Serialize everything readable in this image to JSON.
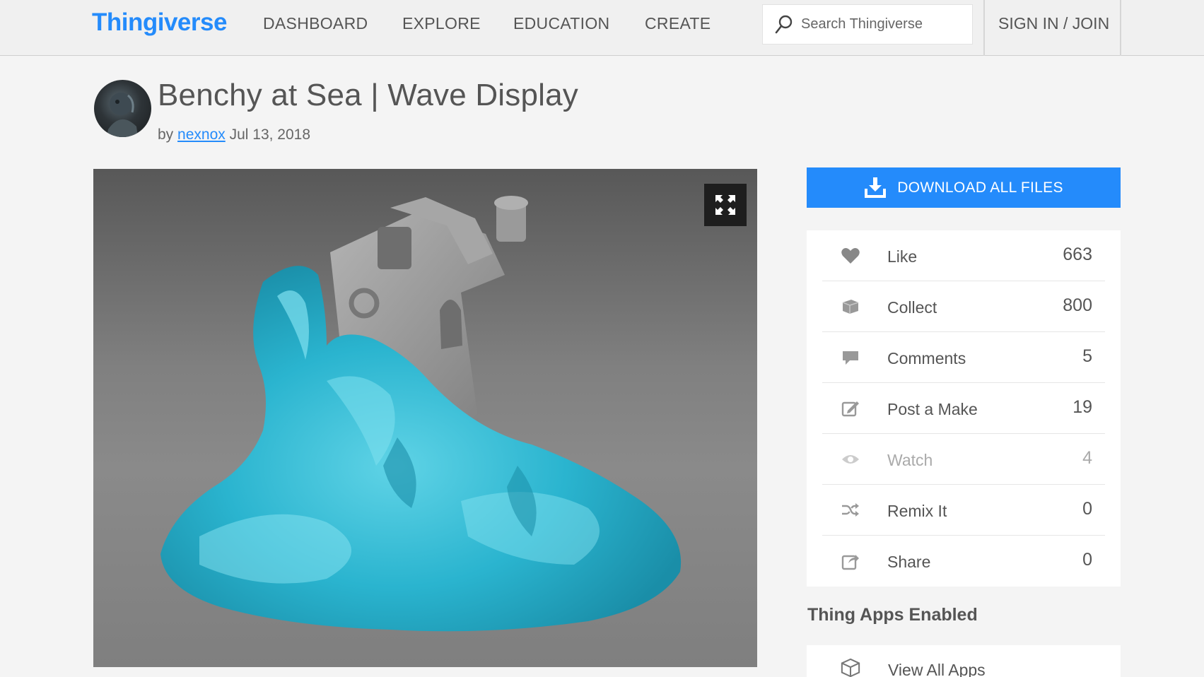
{
  "header": {
    "logo": "Thingiverse",
    "nav": [
      "DASHBOARD",
      "EXPLORE",
      "EDUCATION",
      "CREATE"
    ],
    "search_placeholder": "Search Thingiverse",
    "signin": "SIGN IN / JOIN"
  },
  "thing": {
    "title": "Benchy at Sea | Wave Display",
    "by": "by",
    "author": "nexnox",
    "date": "Jul 13, 2018"
  },
  "sidebar": {
    "download_label": "DOWNLOAD ALL FILES",
    "actions": [
      {
        "label": "Like",
        "count": "663",
        "icon": "heart-icon"
      },
      {
        "label": "Collect",
        "count": "800",
        "icon": "collect-icon"
      },
      {
        "label": "Comments",
        "count": "5",
        "icon": "comment-icon"
      },
      {
        "label": "Post a Make",
        "count": "19",
        "icon": "edit-icon"
      },
      {
        "label": "Watch",
        "count": "4",
        "icon": "eye-icon"
      },
      {
        "label": "Remix It",
        "count": "0",
        "icon": "shuffle-icon"
      },
      {
        "label": "Share",
        "count": "0",
        "icon": "share-icon"
      }
    ],
    "apps_heading": "Thing Apps Enabled",
    "apps_link": "View All Apps"
  },
  "colors": {
    "brand": "#248bfb",
    "background": "#f4f4f4",
    "wave": "#2ab4cf",
    "boat": "#9a9a9a"
  }
}
